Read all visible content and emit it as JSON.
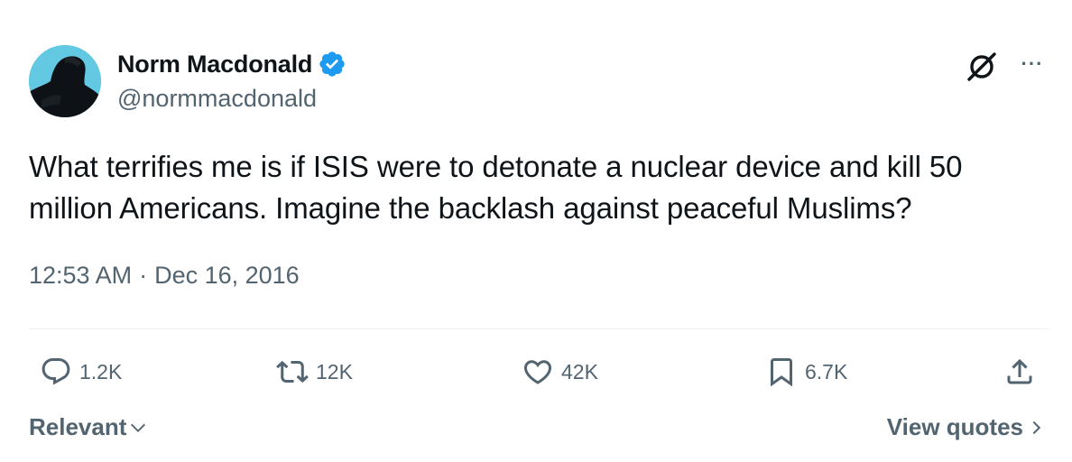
{
  "author": {
    "display_name": "Norm Macdonald",
    "handle": "@normmacdonald",
    "verified": true,
    "verified_color": "#1d9bf0"
  },
  "tweet": {
    "text": "What terrifies me is if ISIS were to detonate a nuclear device and kill 50 million Americans. Imagine the backlash against peaceful Muslims?",
    "time": "12:53 AM",
    "separator": "·",
    "date": "Dec 16, 2016"
  },
  "header_icons": {
    "grok": "grok-icon",
    "more": "more-icon",
    "more_label": "···"
  },
  "actions": {
    "replies": "1.2K",
    "reposts": "12K",
    "likes": "42K",
    "bookmarks": "6.7K"
  },
  "footer": {
    "sort_label": "Relevant",
    "view_quotes_label": "View quotes"
  },
  "colors": {
    "text_primary": "#0f1419",
    "text_secondary": "#536471",
    "divider": "#eff3f4"
  }
}
